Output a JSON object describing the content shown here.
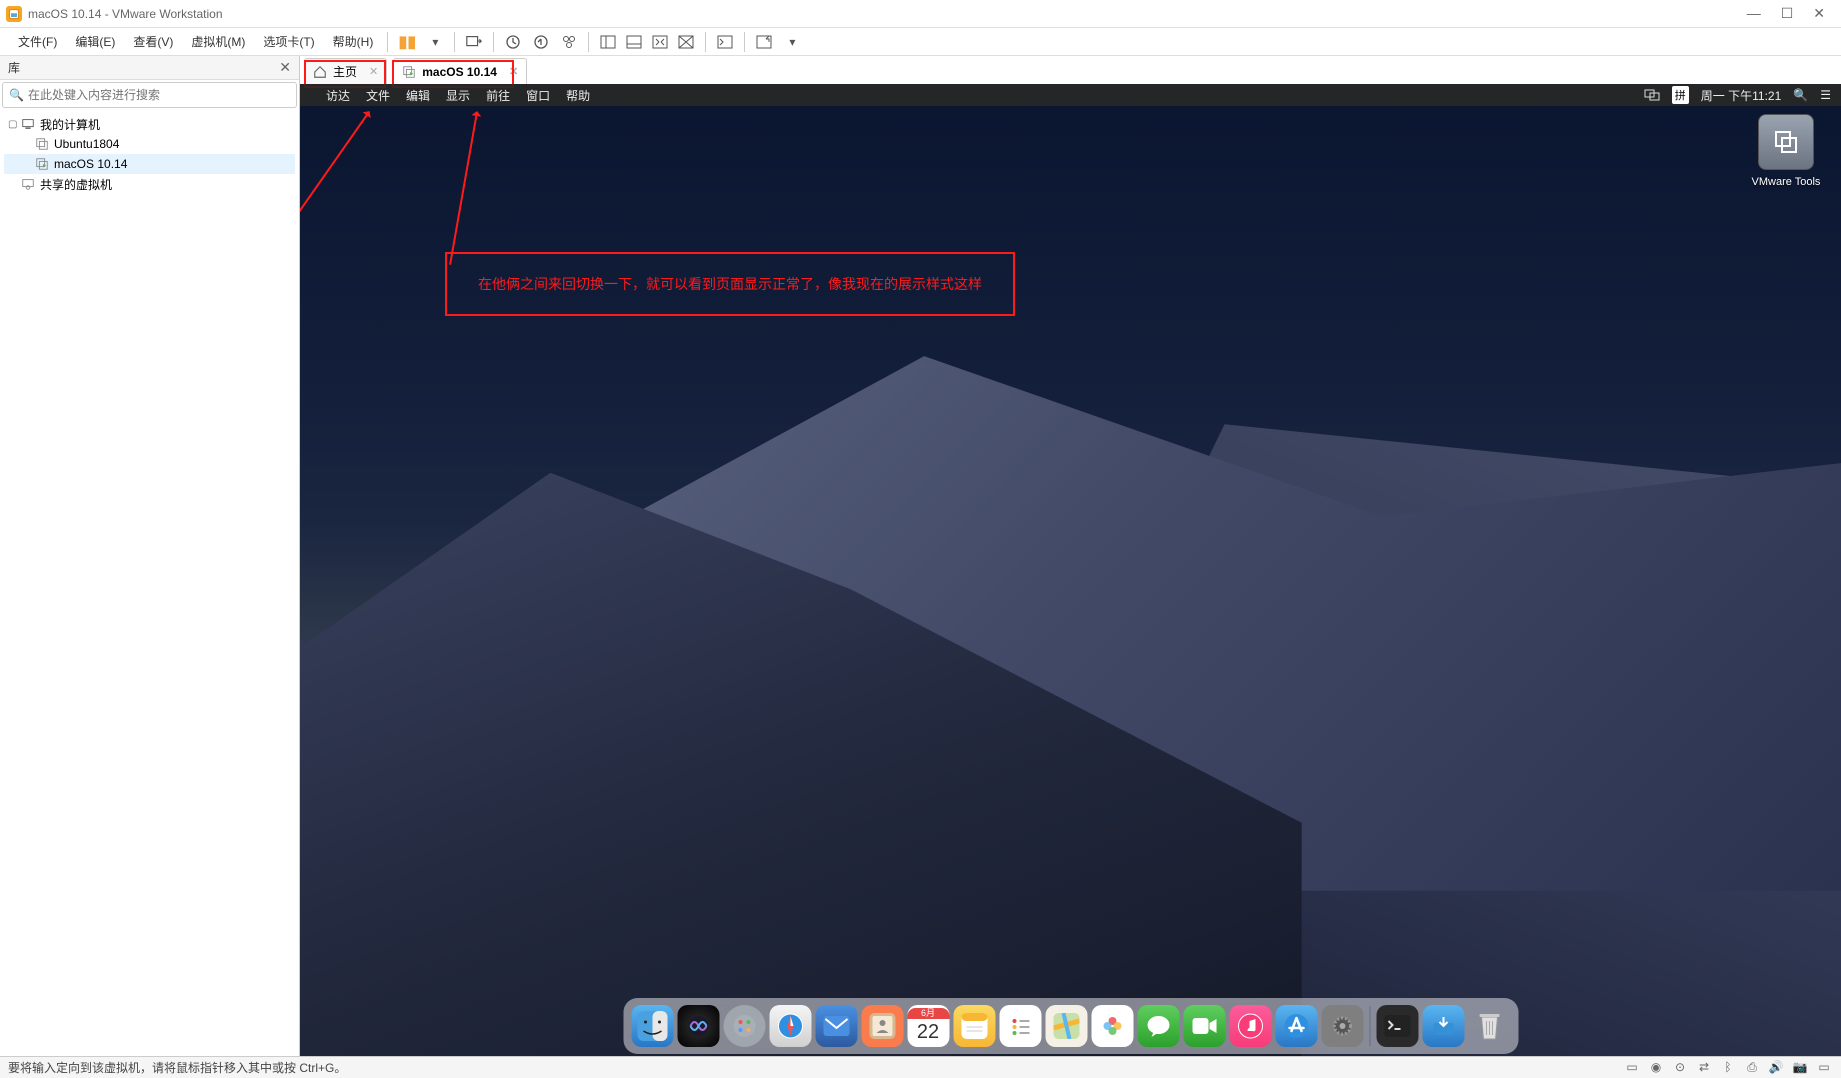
{
  "window": {
    "title": "macOS 10.14 - VMware Workstation"
  },
  "menus": {
    "file": "文件(F)",
    "edit": "编辑(E)",
    "view": "查看(V)",
    "vm": "虚拟机(M)",
    "tabs": "选项卡(T)",
    "help": "帮助(H)"
  },
  "sidebar": {
    "title": "库",
    "search_placeholder": "在此处键入内容进行搜索",
    "tree": {
      "root": "我的计算机",
      "items": [
        "Ubuntu1804",
        "macOS 10.14"
      ],
      "shared": "共享的虚拟机"
    }
  },
  "tabs": {
    "home": "主页",
    "vm": "macOS 10.14"
  },
  "mac_menu": {
    "finder": "访达",
    "file": "文件",
    "edit": "编辑",
    "show": "显示",
    "goto": "前往",
    "window": "窗口",
    "help": "帮助",
    "input": "拼",
    "datetime": "周一 下午11:21"
  },
  "desktop": {
    "vmware_tools": "VMware Tools"
  },
  "annotation": {
    "text": "在他俩之间来回切换一下，就可以看到页面显示正常了，像我现在的展示样式这样"
  },
  "dock": {
    "calendar_month": "6月",
    "calendar_day": "22"
  },
  "statusbar": {
    "hint": "要将输入定向到该虚拟机，请将鼠标指针移入其中或按 Ctrl+G。"
  }
}
